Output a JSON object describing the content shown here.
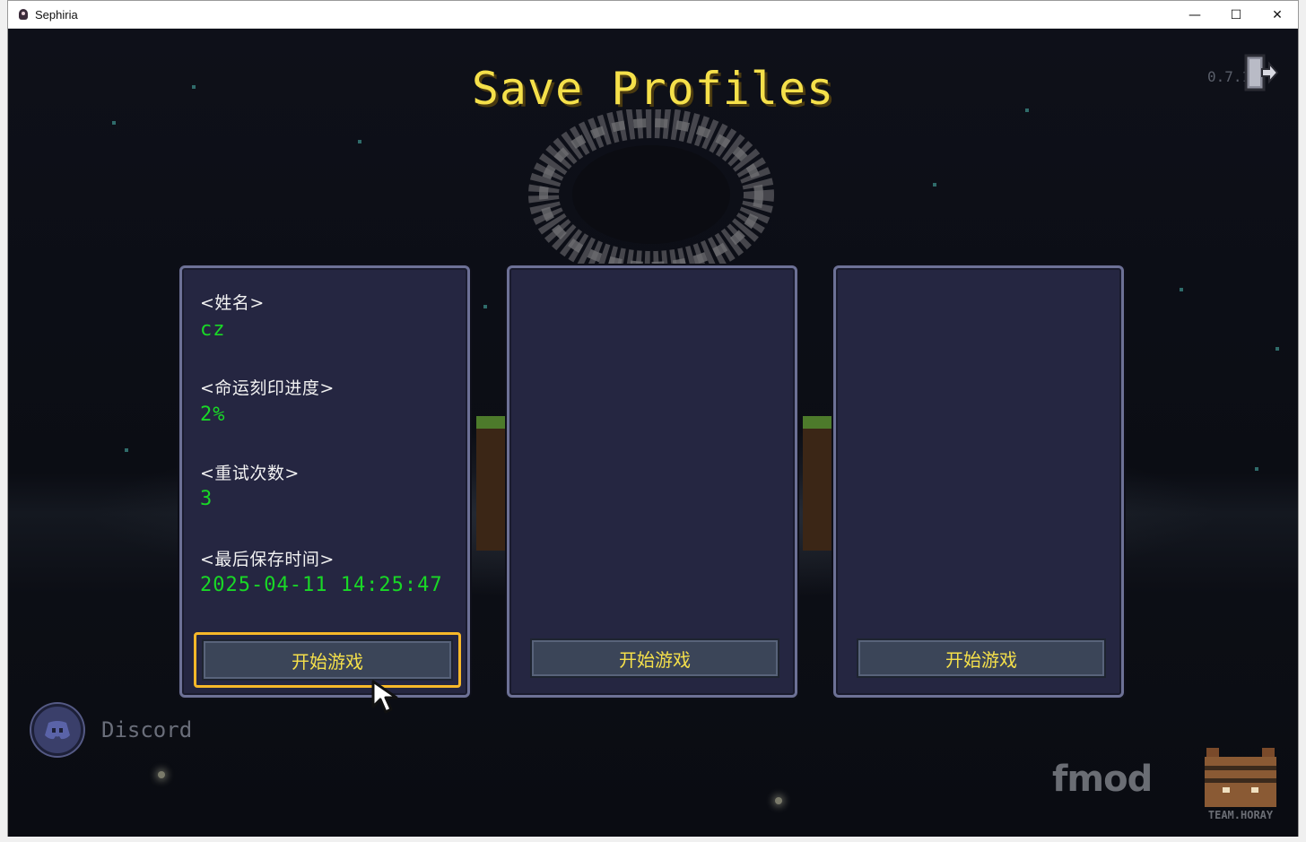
{
  "window": {
    "title": "Sephiria",
    "controls": {
      "minimize": "—",
      "maximize": "☐",
      "close": "✕"
    }
  },
  "header": {
    "title": "Save Profiles",
    "version": "0.7.1"
  },
  "profiles": [
    {
      "fields": [
        {
          "label": "<姓名>",
          "value": "cz"
        },
        {
          "label": "<命运刻印进度>",
          "value": "2%"
        },
        {
          "label": "<重试次数>",
          "value": "3"
        },
        {
          "label": "<最后保存时间>",
          "value": "2025-04-11 14:25:47"
        }
      ],
      "start_label": "开始游戏",
      "selected": true
    },
    {
      "fields": [],
      "start_label": "开始游戏",
      "selected": false
    },
    {
      "fields": [],
      "start_label": "开始游戏",
      "selected": false
    }
  ],
  "footer": {
    "discord_label": "Discord",
    "fmod_logo": "fmod",
    "team_logo": "TEAM.HORAY"
  },
  "colors": {
    "title_yellow": "#f5e04a",
    "value_green": "#19d826",
    "card_bg": "#252641",
    "card_border": "#6d7196",
    "selected_border": "#f7b829"
  },
  "icons": [
    "app-icon",
    "exit-door-icon",
    "discord-icon",
    "mouse-cursor-icon"
  ]
}
